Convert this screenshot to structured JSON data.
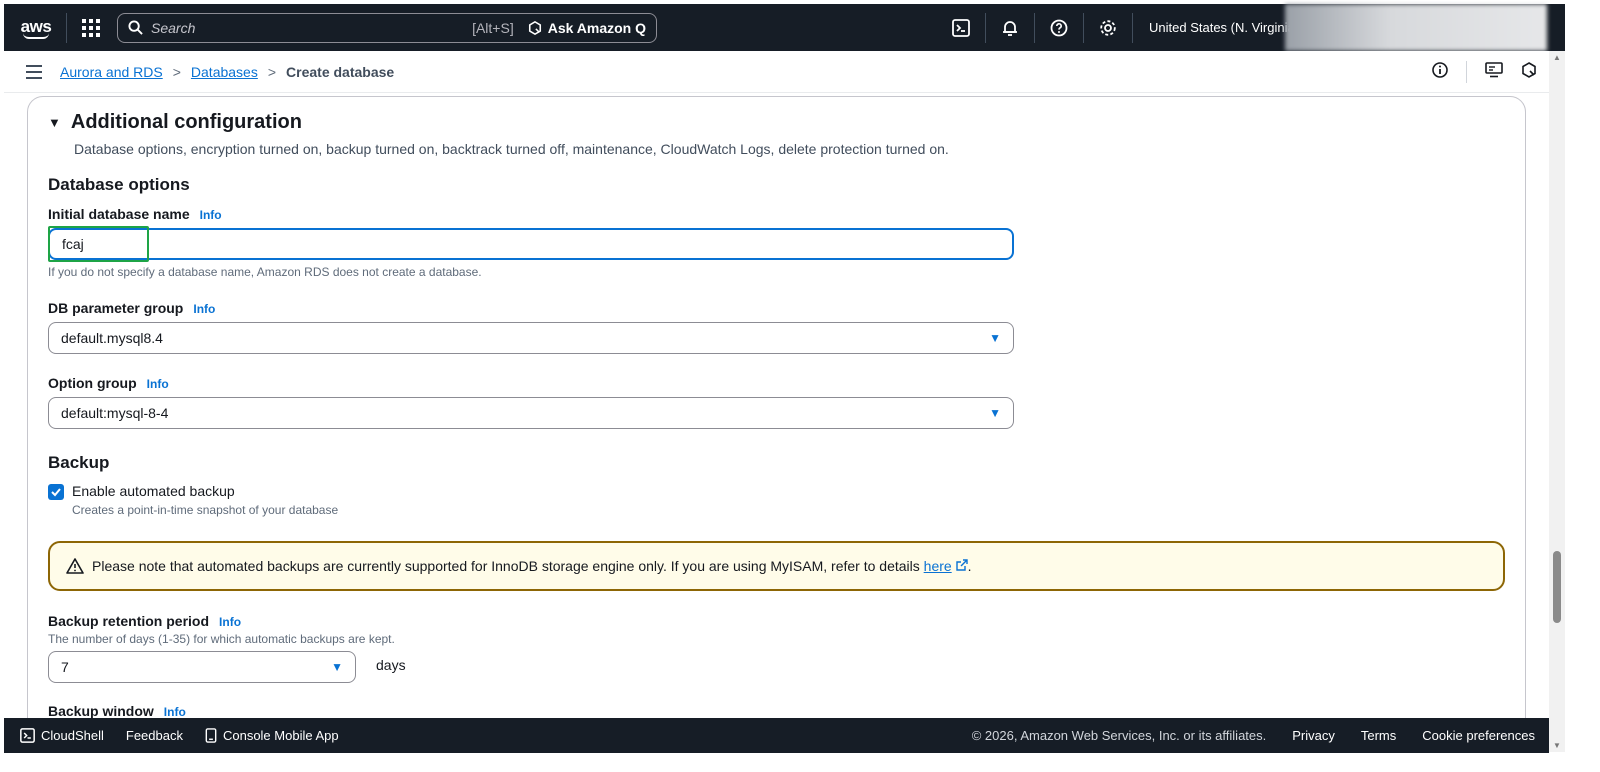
{
  "topnav": {
    "logo_text": "aws",
    "search_placeholder": "Search",
    "search_shortcut": "[Alt+S]",
    "ask_q_label": "Ask Amazon Q",
    "region_label": "United States (N. Virginia)"
  },
  "breadcrumb": {
    "items": [
      "Aurora and RDS",
      "Databases"
    ],
    "current": "Create database",
    "separator": ">"
  },
  "section": {
    "title": "Additional configuration",
    "description": "Database options, encryption turned on, backup turned on, backtrack turned off, maintenance, CloudWatch Logs, delete protection turned on."
  },
  "db_options": {
    "heading": "Database options",
    "initial_db_name": {
      "label": "Initial database name",
      "info": "Info",
      "value": "fcaj",
      "help": "If you do not specify a database name, Amazon RDS does not create a database."
    },
    "param_group": {
      "label": "DB parameter group",
      "info": "Info",
      "value": "default.mysql8.4"
    },
    "option_group": {
      "label": "Option group",
      "info": "Info",
      "value": "default:mysql-8-4"
    }
  },
  "backup": {
    "heading": "Backup",
    "enable": {
      "label": "Enable automated backup",
      "description": "Creates a point-in-time snapshot of your database",
      "checked": true
    },
    "alert": {
      "text": "Please note that automated backups are currently supported for InnoDB storage engine only. If you are using MyISAM, refer to details",
      "link": "here",
      "suffix": "."
    },
    "retention": {
      "label": "Backup retention period",
      "info": "Info",
      "help": "The number of days (1-35) for which automatic backups are kept.",
      "value": "7",
      "unit": "days"
    },
    "window": {
      "label": "Backup window",
      "info": "Info"
    }
  },
  "footer": {
    "cloudshell": "CloudShell",
    "feedback": "Feedback",
    "mobile_app": "Console Mobile App",
    "copyright": "© 2026, Amazon Web Services, Inc. or its affiliates.",
    "privacy": "Privacy",
    "terms": "Terms",
    "cookies": "Cookie preferences"
  },
  "colors": {
    "nav_bg": "#161d26",
    "link": "#0972d3",
    "highlight": "#1ea446",
    "alert_border": "#8d6605",
    "alert_bg": "#fffce9"
  }
}
